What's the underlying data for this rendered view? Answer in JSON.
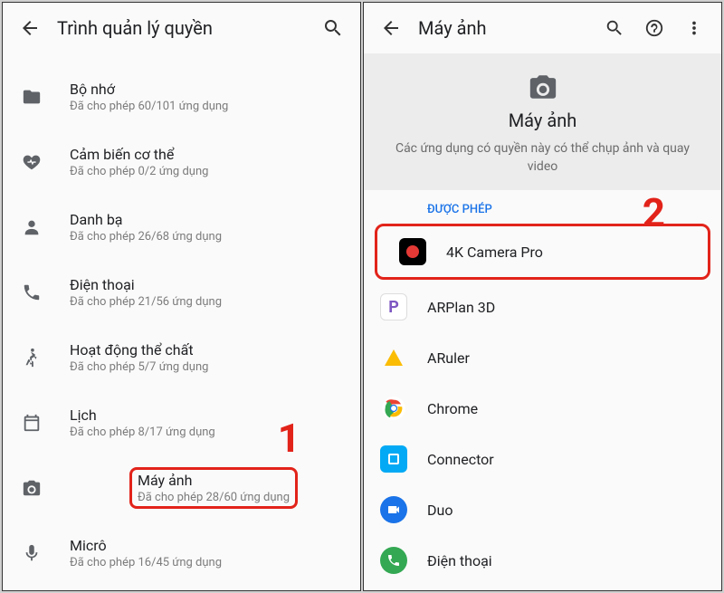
{
  "left": {
    "title": "Trình quản lý quyền",
    "items": [
      {
        "icon": "folder",
        "title": "Bộ nhớ",
        "sub": "Đã cho phép 60/101 ứng dụng"
      },
      {
        "icon": "heart",
        "title": "Cảm biến cơ thể",
        "sub": "Đã cho phép 0/2 ứng dụng"
      },
      {
        "icon": "person",
        "title": "Danh bạ",
        "sub": "Đã cho phép 26/68 ứng dụng"
      },
      {
        "icon": "phone",
        "title": "Điện thoại",
        "sub": "Đã cho phép 21/56 ứng dụng"
      },
      {
        "icon": "activity",
        "title": "Hoạt động thể chất",
        "sub": "Đã cho phép 5/7 ứng dụng"
      },
      {
        "icon": "calendar",
        "title": "Lịch",
        "sub": "Đã cho phép 8/17 ứng dụng"
      },
      {
        "icon": "camera",
        "title": "Máy ảnh",
        "sub": "Đã cho phép 28/60 ứng dụng"
      },
      {
        "icon": "mic",
        "title": "Micrô",
        "sub": "Đã cho phép 16/45 ứng dụng"
      }
    ],
    "annotation": "1"
  },
  "right": {
    "title": "Máy ảnh",
    "big_title": "Máy ảnh",
    "big_desc": "Các ứng dụng có quyền này có thể chụp ảnh và quay video",
    "section": "ĐƯỢC PHÉP",
    "apps": [
      {
        "name": "4K Camera Pro",
        "bg": "#000000",
        "inner": "#e53935",
        "shape": "dot"
      },
      {
        "name": "ARPlan 3D",
        "bg": "#ffffff",
        "fg": "#7e57c2",
        "letter": "P",
        "border": true
      },
      {
        "name": "ARuler",
        "bg": "transparent",
        "fg": "#fbbc04",
        "letter": "A",
        "tri": true
      },
      {
        "name": "Chrome",
        "chrome": true
      },
      {
        "name": "Connector",
        "bg": "#03a9f4",
        "fg": "#ffffff",
        "square": true
      },
      {
        "name": "Duo",
        "bg": "#1a73e8",
        "circle": true
      },
      {
        "name": "Điện thoại",
        "bg": "#34a853",
        "phone": true
      }
    ],
    "annotation": "2"
  }
}
